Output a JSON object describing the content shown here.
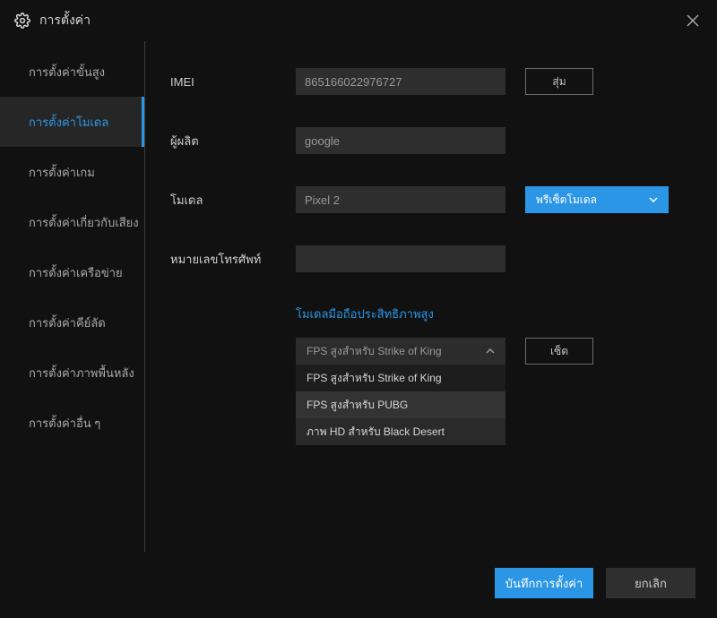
{
  "title": "การตั้งค่า",
  "sidebar": {
    "items": [
      {
        "label": "การตั้งค่าขั้นสูง"
      },
      {
        "label": "การตั้งค่าโมเดล"
      },
      {
        "label": "การตั้งค่าเกม"
      },
      {
        "label": "การตั้งค่าเกี่ยวกับเสียง"
      },
      {
        "label": "การตั้งค่าเครือข่าย"
      },
      {
        "label": "การตั้งค่าคีย์ลัด"
      },
      {
        "label": "การตั้งค่าภาพพื้นหลัง"
      },
      {
        "label": "การตั้งค่าอื่น ๆ"
      }
    ],
    "active_index": 1
  },
  "form": {
    "imei_label": "IMEI",
    "imei_value": "865166022976727",
    "random_btn": "สุ่ม",
    "maker_label": "ผู้ผลิต",
    "maker_value": "google",
    "model_label": "โมเดล",
    "model_value": "Pixel 2",
    "preset_label": "พรีเซ็ตโมเดล",
    "phone_label": "หมายเลขโทรศัพท์",
    "phone_value": ""
  },
  "perf": {
    "heading": "โมเดลมือถือประสิทธิภาพสูง",
    "selected": "FPS สูงสำหรับ Strike of King",
    "options": [
      "FPS สูงสำหรับ Strike of King",
      "FPS สูงสำหรับ PUBG",
      "ภาพ HD สำหรับ Black Desert"
    ],
    "set_btn": "เซ็ต"
  },
  "footer": {
    "save": "บันทึกการตั้งค่า",
    "cancel": "ยกเลิก"
  }
}
